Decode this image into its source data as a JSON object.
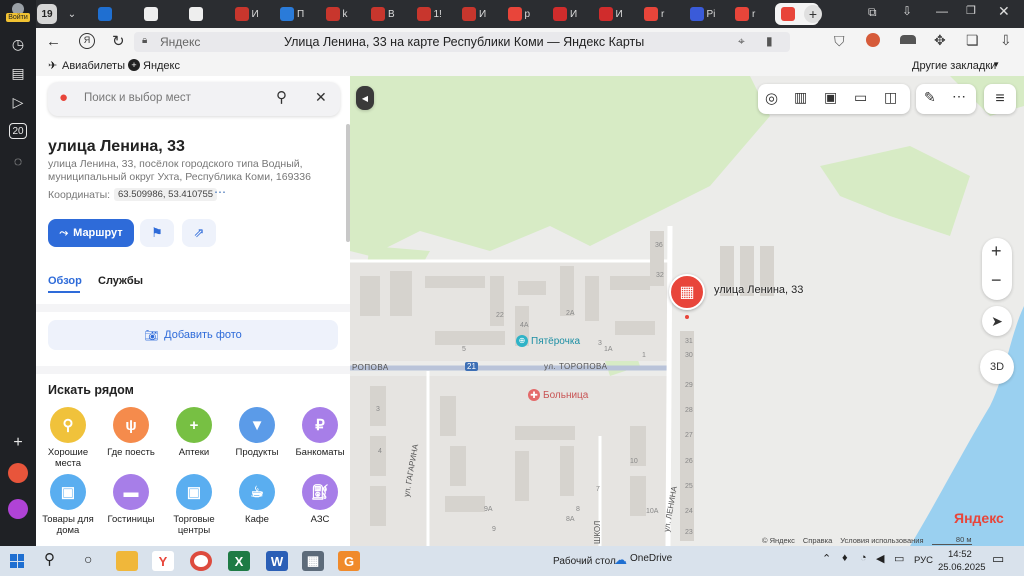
{
  "sidebar": {
    "login_label": "Войти",
    "counter": "20"
  },
  "tabs": {
    "count_badge": "19",
    "items": [
      {
        "icon": "yandex-maps-icon",
        "label": ""
      },
      {
        "icon": "doc-icon",
        "label": ""
      },
      {
        "icon": "doc-icon",
        "label": ""
      },
      {
        "icon": "pdf-icon",
        "label": "И"
      },
      {
        "icon": "mail-icon",
        "label": "П"
      },
      {
        "icon": "pdf-icon",
        "label": "k"
      },
      {
        "icon": "pdf-icon",
        "label": "В"
      },
      {
        "icon": "pdf-icon",
        "label": "1!"
      },
      {
        "icon": "pdf-icon",
        "label": "И"
      },
      {
        "icon": "yandex-icon",
        "label": "p"
      },
      {
        "icon": "rts-icon",
        "label": "И"
      },
      {
        "icon": "rts-icon",
        "label": "И"
      },
      {
        "icon": "yandex-icon",
        "label": "r"
      },
      {
        "icon": "p-icon",
        "label": "Pi"
      },
      {
        "icon": "yandex-icon",
        "label": "r"
      },
      {
        "icon": "map-pin-icon",
        "label": "",
        "active": true
      }
    ]
  },
  "address_bar": {
    "site_label": "Яндекс",
    "page_title": "Улица Ленина, 33 на карте Республики Коми — Яндекс Карты"
  },
  "bookmarks": {
    "items": [
      "Авиабилеты",
      "Яндекс"
    ],
    "other": "Другие закладки"
  },
  "panel": {
    "search_placeholder": "Поиск и выбор мест",
    "title": "улица Ленина, 33",
    "address_line1": "улица Ленина, 33, посёлок городского типа Водный,",
    "address_line2": "муниципальный округ Ухта, Республика Коми, 169336",
    "coords_label": "Координаты:",
    "coords_value": "63.509986, 53.410755",
    "route_label": "Маршрут",
    "tab_overview": "Обзор",
    "tab_services": "Службы",
    "add_photo": "Добавить фото",
    "nearby_title": "Искать рядом",
    "categories_row1": [
      {
        "label": "Хорошие места",
        "color": "#f0c23b",
        "icon": "pin-laurel-icon"
      },
      {
        "label": "Где поесть",
        "color": "#f58b4c",
        "icon": "fork-knife-icon"
      },
      {
        "label": "Аптеки",
        "color": "#77c043",
        "icon": "plus-icon"
      },
      {
        "label": "Продукты",
        "color": "#5b9be8",
        "icon": "basket-icon"
      },
      {
        "label": "Банкоматы",
        "color": "#a77ee8",
        "icon": "ruble-icon"
      }
    ],
    "categories_row2": [
      {
        "label": "Товары для дома",
        "color": "#5aaef0",
        "icon": "bag-icon"
      },
      {
        "label": "Гостиницы",
        "color": "#a77ee8",
        "icon": "bed-icon"
      },
      {
        "label": "Торговые центры",
        "color": "#5aaef0",
        "icon": "bag-icon"
      },
      {
        "label": "Кафе",
        "color": "#5aaef0",
        "icon": "cup-icon"
      },
      {
        "label": "АЗС",
        "color": "#a77ee8",
        "icon": "fuel-icon"
      }
    ]
  },
  "map": {
    "marker_label": "улица Ленина, 33",
    "poi_shop": "Пятёрочка",
    "poi_hospital": "Больница",
    "street_toropova": "ул. ТОРОПОВА",
    "street_toropova_left": "РОПОВА",
    "street_gagarina": "ул. ГАГАРИНА",
    "street_lenina": "ул. ЛЕНИНА",
    "street_shkol": "ШКОЛ",
    "road_number": "21",
    "buildings": [
      "36",
      "32",
      "31",
      "30",
      "29",
      "28",
      "27",
      "26",
      "25",
      "24",
      "23",
      "22",
      "5",
      "4А",
      "2А",
      "3",
      "1А",
      "1",
      "3",
      "4",
      "9А",
      "9",
      "8А",
      "8",
      "7",
      "10А",
      "10"
    ],
    "zoom_in": "+",
    "zoom_out": "−",
    "btn_3d": "3D",
    "logo": "Яндекс",
    "footer_copyright": "© Яндекс",
    "footer_help": "Справка",
    "footer_terms": "Условия использования",
    "scale": "80 м"
  },
  "taskbar": {
    "desktop_label": "Рабочий стол",
    "onedrive_label": "OneDrive",
    "lang": "РУС",
    "time": "14:52",
    "date": "25.06.2025"
  }
}
